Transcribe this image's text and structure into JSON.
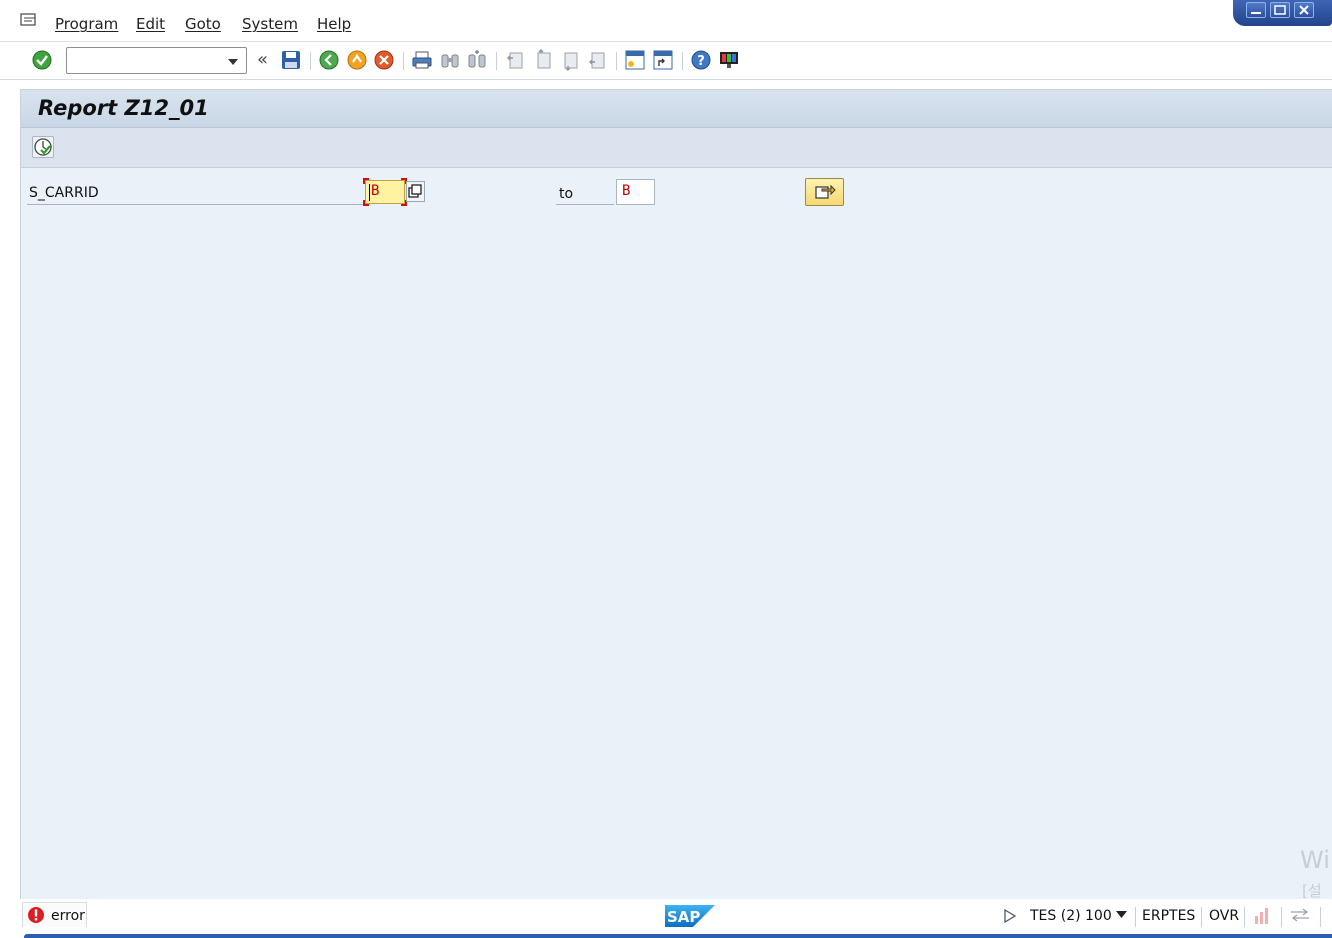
{
  "menubar": {
    "items": [
      "Program",
      "Edit",
      "Goto",
      "System",
      "Help"
    ]
  },
  "toolbar": {
    "command_field_value": "",
    "icons": [
      "enter-icon",
      "save-icon",
      "back-icon",
      "exit-icon",
      "cancel-icon",
      "print-icon",
      "find-icon",
      "find-next-icon",
      "first-page-icon",
      "previous-page-icon",
      "next-page-icon",
      "last-page-icon",
      "create-session-icon",
      "shortcut-icon",
      "help-icon",
      "customize-layout-icon"
    ]
  },
  "screen": {
    "title": "Report Z12_01"
  },
  "selection": {
    "field_label": "S_CARRID",
    "low_value": "B",
    "to_label": "to",
    "high_value": "B"
  },
  "status": {
    "message_type": "error",
    "message_label": "error",
    "system_info": "TES (2) 100",
    "server": "ERPTES",
    "input_mode": "OVR"
  },
  "colors": {
    "accent": "#2d5fae",
    "background": "#eaf1f8",
    "input_highlight": "#fdf3a3",
    "error_red": "#d01010"
  },
  "watermark": {
    "line1": "Wi",
    "line2": "[설정"
  }
}
